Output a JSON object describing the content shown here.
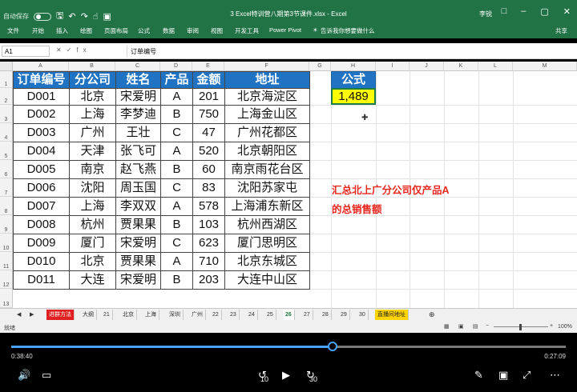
{
  "titlebar": {
    "autosave": "自动保存",
    "title": "3 Excel特训营八期第3节课件.xlsx  -  Excel",
    "user": "李锐"
  },
  "ribbon": {
    "tabs": [
      "文件",
      "开始",
      "插入",
      "绘图",
      "页面布局",
      "公式",
      "数据",
      "审阅",
      "视图",
      "开发工具",
      "Power Pivot"
    ],
    "tell_me": "告诉我你想要做什么",
    "share": "共享"
  },
  "formula_bar": {
    "name_box": "A1",
    "content": "订单编号"
  },
  "columns": [
    "A",
    "B",
    "C",
    "D",
    "E",
    "F",
    "G",
    "H",
    "I",
    "J",
    "K",
    "L",
    "M"
  ],
  "rows": [
    "1",
    "2",
    "3",
    "4",
    "5",
    "6",
    "7",
    "8",
    "9",
    "10",
    "11",
    "12",
    "13"
  ],
  "table": {
    "headers": [
      "订单编号",
      "分公司",
      "姓名",
      "产品",
      "金额",
      "地址"
    ],
    "rows": [
      [
        "D001",
        "北京",
        "宋爱明",
        "A",
        "201",
        "北京海淀区"
      ],
      [
        "D002",
        "上海",
        "李梦迪",
        "B",
        "750",
        "上海金山区"
      ],
      [
        "D003",
        "广州",
        "王壮",
        "C",
        "47",
        "广州花都区"
      ],
      [
        "D004",
        "天津",
        "张飞可",
        "A",
        "520",
        "北京朝阳区"
      ],
      [
        "D005",
        "南京",
        "赵飞燕",
        "B",
        "60",
        "南京雨花台区"
      ],
      [
        "D006",
        "沈阳",
        "周玉国",
        "C",
        "83",
        "沈阳苏家屯"
      ],
      [
        "D007",
        "上海",
        "李双双",
        "A",
        "578",
        "上海浦东新区"
      ],
      [
        "D008",
        "杭州",
        "贾果果",
        "B",
        "103",
        "杭州西湖区"
      ],
      [
        "D009",
        "厦门",
        "宋爱明",
        "C",
        "623",
        "厦门思明区"
      ],
      [
        "D010",
        "北京",
        "贾果果",
        "A",
        "710",
        "北京东城区"
      ],
      [
        "D011",
        "大连",
        "宋爱明",
        "B",
        "203",
        "大连中山区"
      ]
    ]
  },
  "formula_box": {
    "header": "公式",
    "value": "1,489"
  },
  "note": {
    "line1": "汇总北上广分公司仅产品A",
    "line2": "的总销售额"
  },
  "sheet_tabs": [
    "进群方法",
    "大纲",
    "21",
    "北京",
    "上海",
    "深圳",
    "广州",
    "22",
    "23",
    "24",
    "25",
    "26",
    "27",
    "28",
    "29",
    "30",
    "直播间地址"
  ],
  "active_sheet": "26",
  "status": {
    "ready": "就绪",
    "zoom": "100%"
  },
  "player": {
    "current_time": "0:38:40",
    "total_time": "0:27:09",
    "progress": 0.58,
    "skip_back": "10",
    "skip_forward": "30"
  },
  "colors": {
    "excel_green": "#217346",
    "header_blue": "#1f73c2",
    "highlight_yellow": "#ffff00",
    "note_red": "#e8241c",
    "progress_blue": "#4aa3ff"
  }
}
